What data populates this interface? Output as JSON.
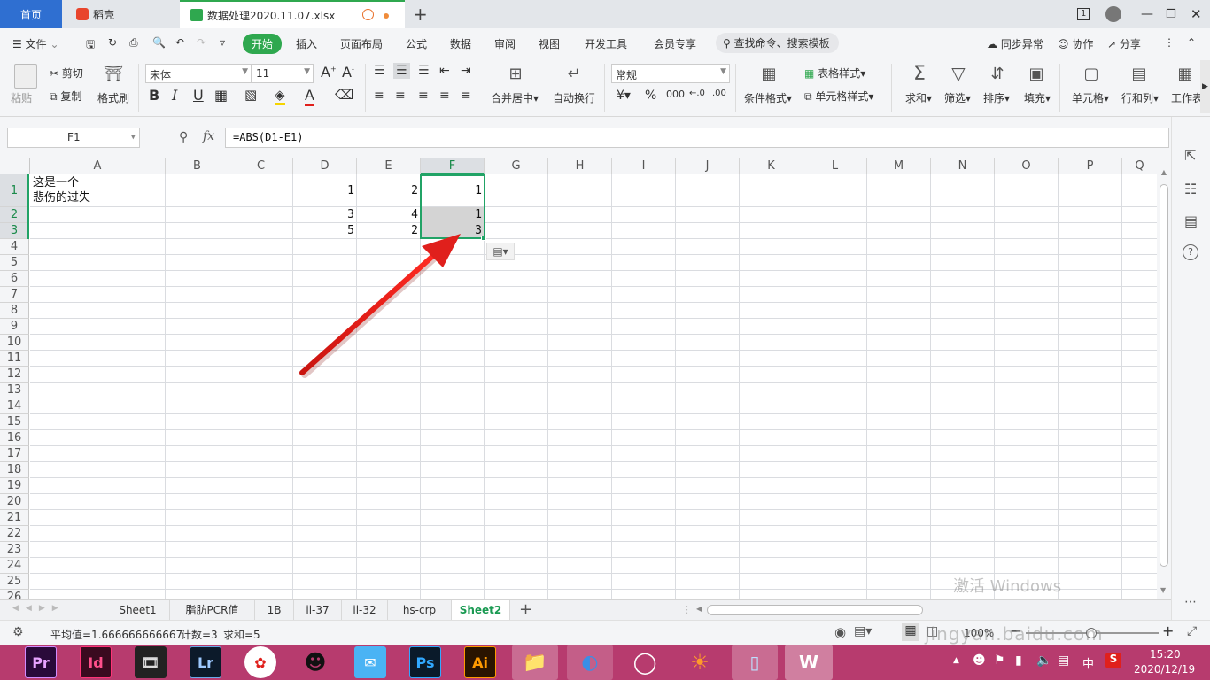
{
  "tabs": {
    "home": "首页",
    "shell": "稻壳",
    "file": "数据处理2020.11.07.xlsx",
    "page_num": "1"
  },
  "menu": {
    "file": "文件",
    "items": [
      "开始",
      "插入",
      "页面布局",
      "公式",
      "数据",
      "审阅",
      "视图",
      "开发工具",
      "会员专享"
    ],
    "search": "查找命令、搜索模板",
    "sync": "同步异常",
    "collab": "协作",
    "share": "分享"
  },
  "ribbon": {
    "paste": "粘贴",
    "cut": "剪切",
    "copy": "复制",
    "format_painter": "格式刷",
    "font_name": "宋体",
    "font_size": "11",
    "merge": "合并居中",
    "wrap": "自动换行",
    "number_format": "常规",
    "cond_format": "条件格式",
    "table_style": "表格样式",
    "cell_style": "单元格样式",
    "sum": "求和",
    "filter": "筛选",
    "sort": "排序",
    "fill": "填充",
    "cell": "单元格",
    "rowcol": "行和列",
    "worksheet": "工作表"
  },
  "formula": {
    "name_box": "F1",
    "fx": "fx",
    "content": "=ABS(D1-E1)"
  },
  "columns": [
    "A",
    "B",
    "C",
    "D",
    "E",
    "F",
    "G",
    "H",
    "I",
    "J",
    "K",
    "L",
    "M",
    "N",
    "O",
    "P",
    "Q"
  ],
  "rows": [
    "1",
    "2",
    "3",
    "4",
    "5",
    "6",
    "7",
    "8",
    "9",
    "10",
    "11",
    "12",
    "13",
    "14",
    "15",
    "16",
    "17",
    "18",
    "19",
    "20",
    "21",
    "22",
    "23",
    "24",
    "25",
    "26"
  ],
  "cells": {
    "A1_line1": "这是一个",
    "A1_line2": "悲伤的过失",
    "D1": "1",
    "E1": "2",
    "F1": "1",
    "D2": "3",
    "E2": "4",
    "F2": "1",
    "D3": "5",
    "E3": "2",
    "F3": "3"
  },
  "sheets": [
    "Sheet1",
    "脂肪PCR值",
    "1B",
    "il-37",
    "il-32",
    "hs-crp",
    "Sheet2"
  ],
  "active_sheet": "Sheet2",
  "status": {
    "average": "平均值=1.666666666667",
    "count": "计数=3",
    "sum": "求和=5",
    "zoom": "100%"
  },
  "taskbar": {
    "apps": [
      "Pr",
      "Id",
      "film",
      "Lr",
      "pinwheel",
      "qq",
      "chat",
      "Ps",
      "Ai",
      "folder",
      "browser",
      "chrome",
      "fox",
      "notebook",
      "wps"
    ],
    "ime": "中",
    "time": "15:20",
    "date": "2020/12/19"
  },
  "watermark": {
    "activate": "激活 Windows",
    "baidu": "jingyan.baidu.com"
  },
  "colors": {
    "accent_green": "#2fa84f",
    "selection_border": "#21a366",
    "arrow_red": "#e0201c",
    "taskbar": "#b73b6e"
  }
}
